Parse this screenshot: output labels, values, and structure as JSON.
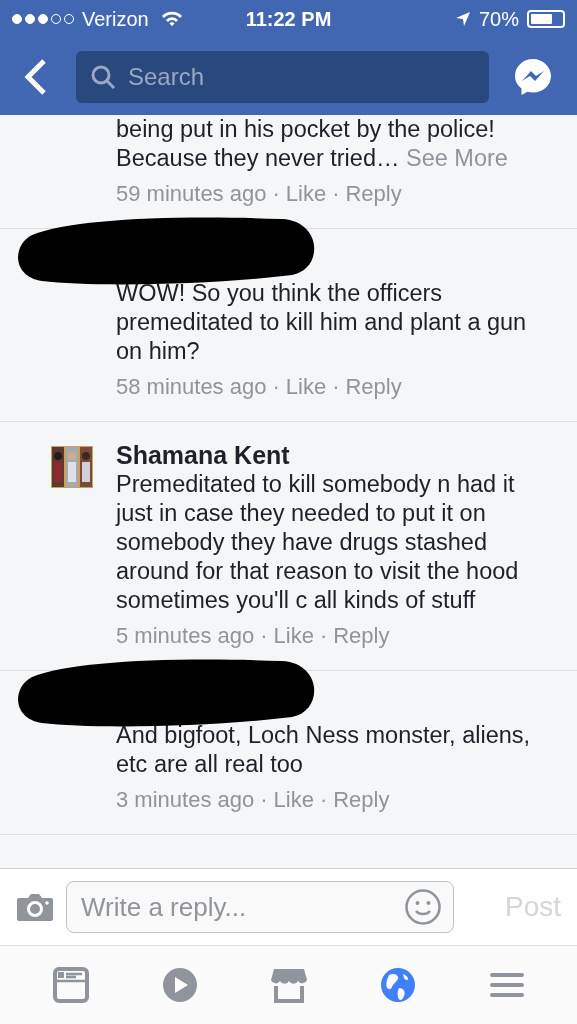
{
  "status_bar": {
    "carrier": "Verizon",
    "time": "11:22 PM",
    "battery": "70%"
  },
  "nav": {
    "search_placeholder": "Search"
  },
  "comments": [
    {
      "text": "being put in his pocket by the police! Because they never tried…",
      "see_more": "See More",
      "time": "59 minutes ago",
      "separator": "·",
      "like": "Like",
      "reply": "Reply",
      "redacted": false,
      "cut_top": true
    },
    {
      "text": "WOW! So you think the officers premeditated to kill him and plant a gun on him?",
      "time": "58 minutes ago",
      "separator": "·",
      "like": "Like",
      "reply": "Reply",
      "redacted": true
    },
    {
      "author": "Shamana Kent",
      "avatar": true,
      "text": "Premeditated to kill somebody n had it just in case they needed to put it on somebody they have drugs stashed around for that reason to visit the hood sometimes you'll c all kinds of stuff",
      "time": "5 minutes ago",
      "separator": "·",
      "like": "Like",
      "reply": "Reply",
      "redacted": false
    },
    {
      "text": "And bigfoot, Loch Ness monster, aliens, etc are all real too",
      "time": "3 minutes ago",
      "separator": "·",
      "like": "Like",
      "reply": "Reply",
      "redacted": true
    }
  ],
  "composer": {
    "placeholder": "Write a reply...",
    "post": "Post",
    "post_disabled": true
  },
  "tab_bar": [
    {
      "kind": "feed",
      "selected": false
    },
    {
      "kind": "video",
      "selected": false
    },
    {
      "kind": "marketplace",
      "selected": false
    },
    {
      "kind": "globe",
      "selected": true
    },
    {
      "kind": "menu",
      "selected": false
    }
  ]
}
